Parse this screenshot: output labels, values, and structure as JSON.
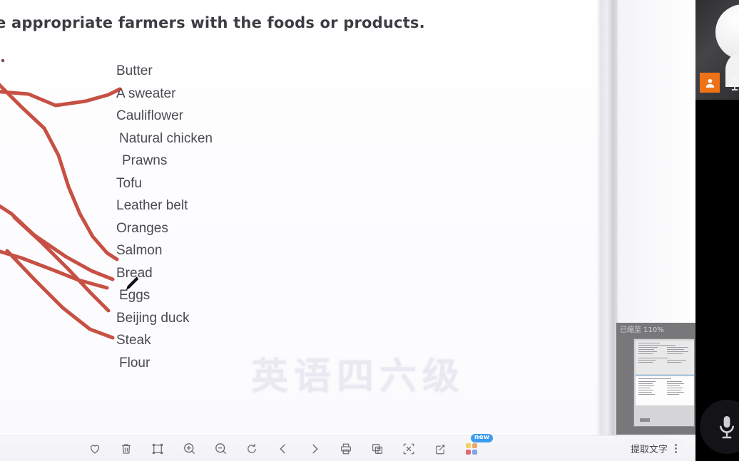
{
  "document": {
    "heading": "e appropriate farmers with the foods or products.",
    "word_list": [
      {
        "text": "Butter",
        "indent": 0
      },
      {
        "text": "A sweater",
        "indent": 0
      },
      {
        "text": "Cauliflower",
        "indent": 0
      },
      {
        "text": "Natural chicken",
        "indent": 1
      },
      {
        "text": "Prawns",
        "indent": 2
      },
      {
        "text": "Tofu",
        "indent": 0
      },
      {
        "text": "Leather belt",
        "indent": 0
      },
      {
        "text": "Oranges",
        "indent": 0
      },
      {
        "text": "Salmon",
        "indent": 0
      },
      {
        "text": "Bread",
        "indent": 0
      },
      {
        "text": "Eggs",
        "indent": 1
      },
      {
        "text": "Beijing duck",
        "indent": 0
      },
      {
        "text": "Steak",
        "indent": 0
      },
      {
        "text": "Flour",
        "indent": 1
      }
    ],
    "watermark": "英语四六级",
    "ink_color": "#c0392b"
  },
  "toolbar": {
    "items": [
      {
        "name": "favorite",
        "icon": "heart-icon"
      },
      {
        "name": "delete",
        "icon": "trash-icon"
      },
      {
        "name": "fit-screen",
        "icon": "crop-frame-icon"
      },
      {
        "name": "zoom-in",
        "icon": "zoom-in-icon"
      },
      {
        "name": "zoom-out",
        "icon": "zoom-out-icon"
      },
      {
        "name": "rotate",
        "icon": "rotate-icon"
      },
      {
        "name": "previous-page",
        "icon": "chevron-left-icon"
      },
      {
        "name": "next-page",
        "icon": "chevron-right-icon"
      },
      {
        "name": "print",
        "icon": "printer-icon"
      },
      {
        "name": "copy-page",
        "icon": "duplicate-icon"
      },
      {
        "name": "scan-select",
        "icon": "scan-icon"
      },
      {
        "name": "annotate",
        "icon": "edit-square-icon"
      },
      {
        "name": "apps",
        "icon": "grid-apps-icon",
        "badge": "new"
      }
    ],
    "extract_text_label": "提取文字",
    "accent_badge_color": "#3b9cf0"
  },
  "zoom_popup": {
    "title": "已缩至 110%",
    "close_label": "✕"
  },
  "video_panel": {
    "participants_icon": "people-icon",
    "microphone_icon": "microphone-icon",
    "mic_button_icon": "microphone-icon",
    "badge_color": "#ef7216"
  }
}
